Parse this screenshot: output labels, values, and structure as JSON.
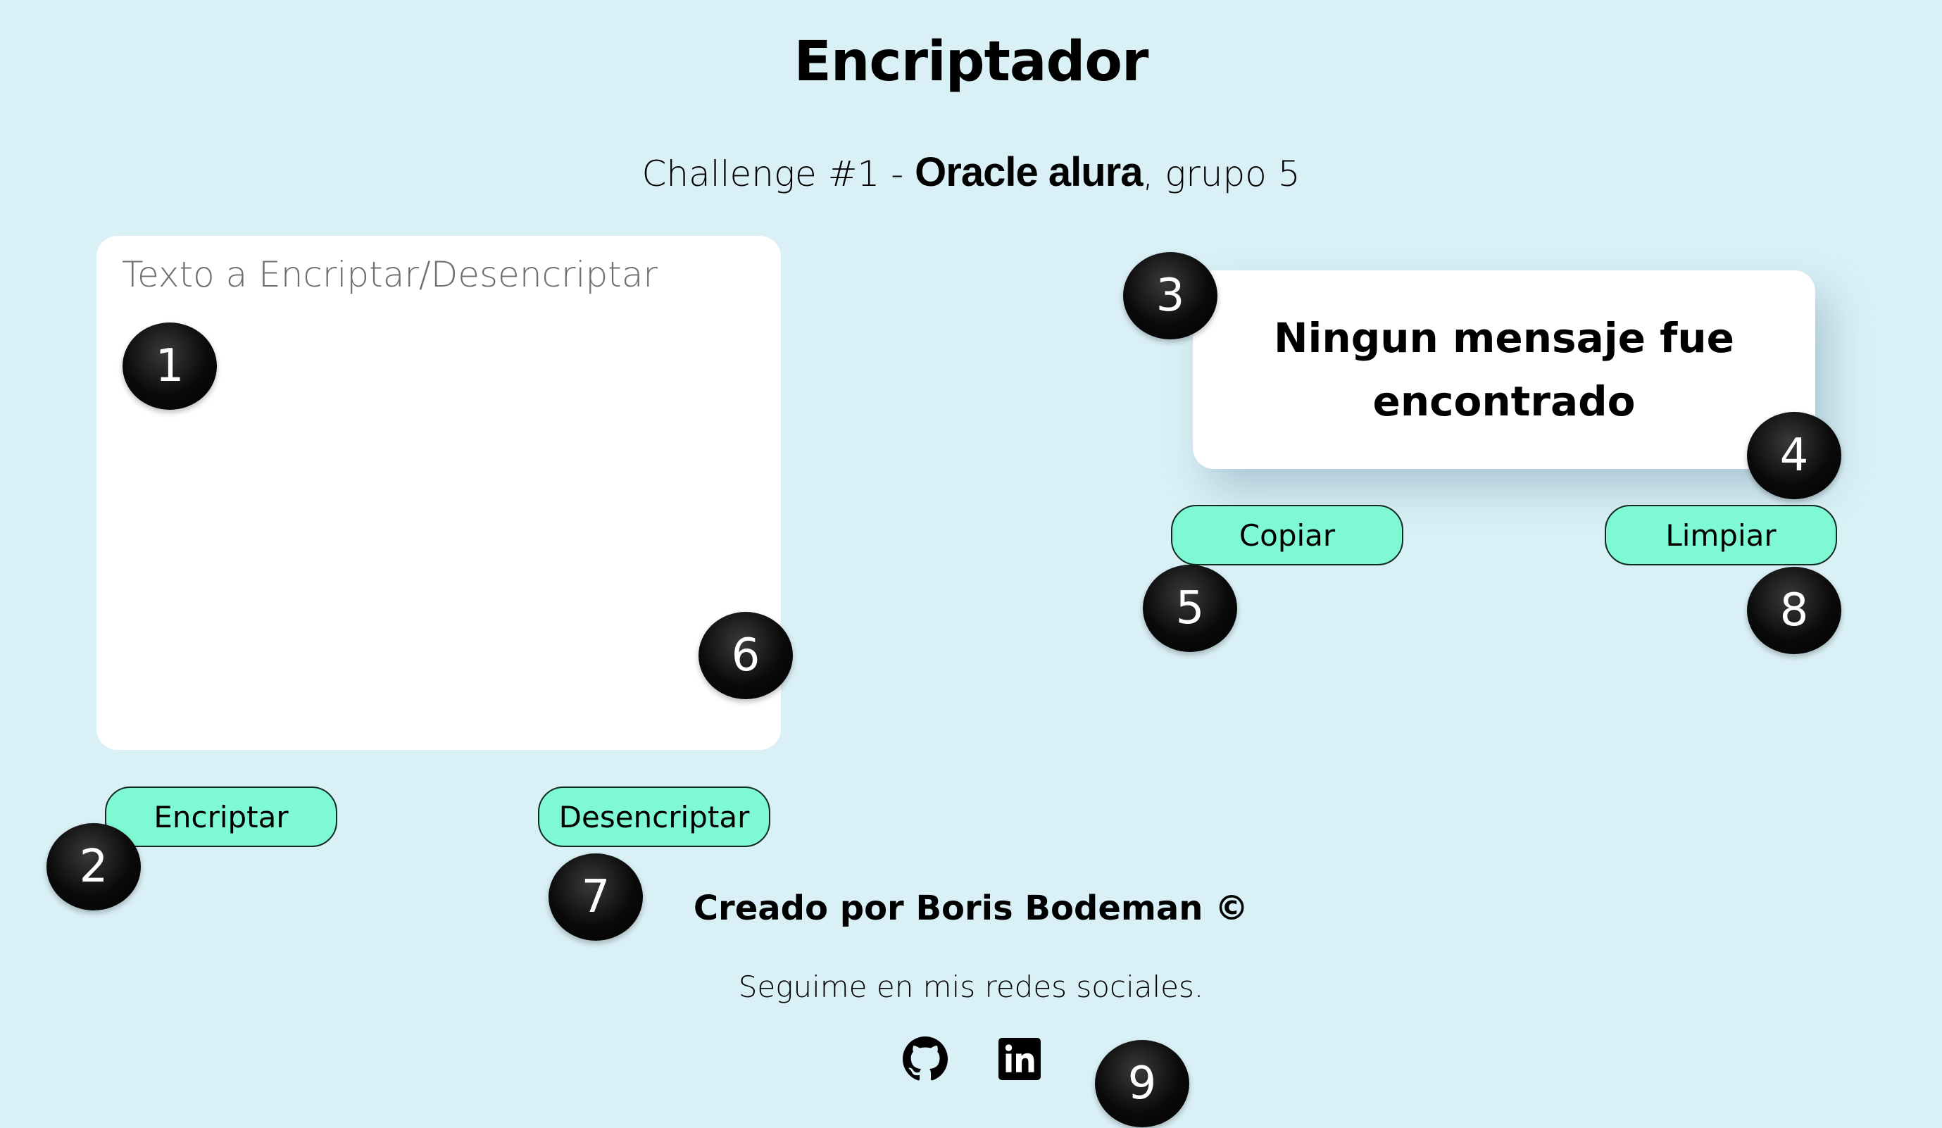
{
  "header": {
    "title": "Encriptador",
    "subtitle_prefix": "Challenge #1 - ",
    "subtitle_brand": "Oracle alura",
    "subtitle_suffix": ", grupo 5"
  },
  "input": {
    "placeholder": "Texto a Encriptar/Desencriptar",
    "value": ""
  },
  "actions": {
    "encrypt_label": "Encriptar",
    "decrypt_label": "Desencriptar"
  },
  "result": {
    "message": "Ningun mensaje fue encontrado",
    "copy_label": "Copiar",
    "clear_label": "Limpiar"
  },
  "footer": {
    "credit": "Creado por Boris Bodeman ©",
    "follow": "Seguime en mis redes sociales.",
    "social": [
      {
        "icon": "github-icon"
      },
      {
        "icon": "linkedin-icon"
      }
    ]
  },
  "markers": [
    "1",
    "2",
    "3",
    "4",
    "5",
    "6",
    "7",
    "8",
    "9"
  ],
  "colors": {
    "background": "#d9f0f6",
    "button": "#7ff8d4",
    "card": "#ffffff"
  }
}
